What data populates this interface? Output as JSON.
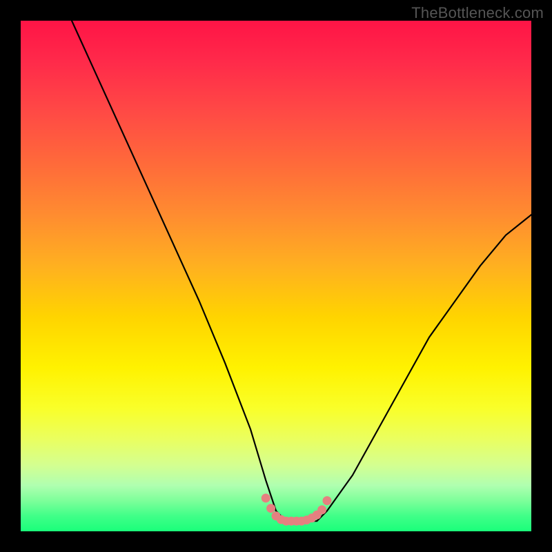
{
  "watermark": "TheBottleneck.com",
  "chart_data": {
    "type": "line",
    "title": "",
    "xlabel": "",
    "ylabel": "",
    "xlim": [
      0,
      100
    ],
    "ylim": [
      0,
      100
    ],
    "series": [
      {
        "name": "curve",
        "x": [
          10,
          15,
          20,
          25,
          30,
          35,
          40,
          45,
          48,
          50,
          52,
          55,
          58,
          60,
          65,
          70,
          75,
          80,
          85,
          90,
          95,
          100
        ],
        "values": [
          100,
          89,
          78,
          67,
          56,
          45,
          33,
          20,
          10,
          4,
          2,
          2,
          2,
          4,
          11,
          20,
          29,
          38,
          45,
          52,
          58,
          62
        ]
      },
      {
        "name": "marker-dots",
        "x": [
          48,
          49,
          50,
          51,
          52,
          53,
          54,
          55,
          56,
          57,
          58,
          59,
          60
        ],
        "values": [
          6.5,
          4.5,
          3.0,
          2.3,
          2.0,
          2.0,
          2.0,
          2.0,
          2.2,
          2.6,
          3.2,
          4.2,
          6.0
        ]
      }
    ],
    "colors": {
      "curve": "#000000",
      "marker": "#e58080"
    }
  }
}
